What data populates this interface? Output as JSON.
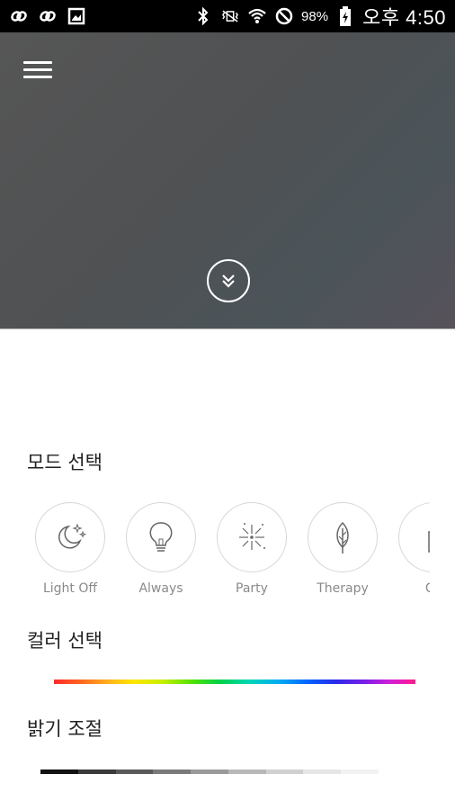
{
  "status_bar": {
    "battery": "98%",
    "time": "오후 4:50",
    "icons": [
      "link-icon",
      "link-icon",
      "image-icon",
      "bluetooth-icon",
      "vibrate-icon",
      "wifi-icon",
      "do-not-disturb-icon",
      "battery-icon"
    ]
  },
  "hero": {
    "menu_icon": "hamburger-menu-icon",
    "expand_icon": "double-chevron-down-icon"
  },
  "mode_section": {
    "title": "모드 선택",
    "modes": [
      {
        "label": "Light Off",
        "icon": "moon-stars-icon"
      },
      {
        "label": "Always",
        "icon": "lightbulb-icon"
      },
      {
        "label": "Party",
        "icon": "firework-icon"
      },
      {
        "label": "Therapy",
        "icon": "leaf-icon"
      },
      {
        "label": "Ca",
        "icon": "candle-icon"
      }
    ]
  },
  "color_section": {
    "title": "컬러 선택"
  },
  "brightness_section": {
    "title": "밝기 조절",
    "steps": [
      "#111111",
      "#3a3a3a",
      "#5a5a5a",
      "#7a7a7a",
      "#9a9a9a",
      "#b8b8b8",
      "#d0d0d0",
      "#e6e6e6",
      "#f2f2f2"
    ]
  }
}
